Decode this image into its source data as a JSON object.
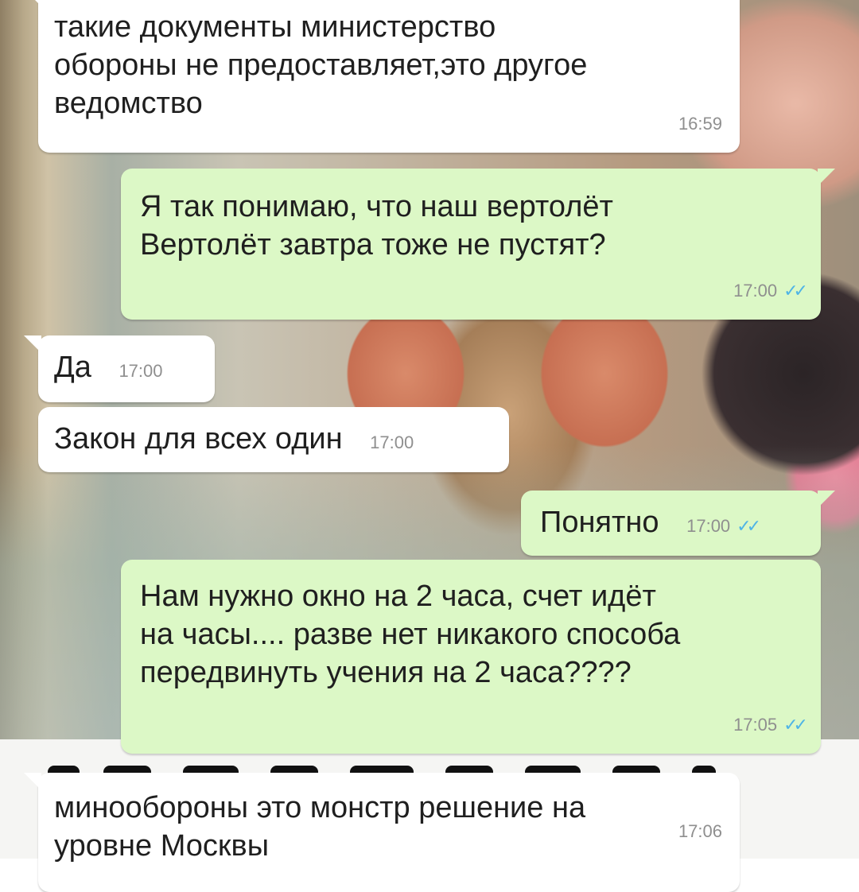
{
  "chat": {
    "messages": [
      {
        "direction": "incoming",
        "text": "такие документы министерство\nобороны не предоставляет,это другое\nведомство",
        "time": "16:59"
      },
      {
        "direction": "outgoing",
        "text": "Я так понимаю, что наш вертолёт\nВертолёт завтра тоже не пустят?",
        "time": "17:00",
        "status": "read-ticks"
      },
      {
        "direction": "incoming",
        "text": "Да",
        "time": "17:00"
      },
      {
        "direction": "incoming",
        "text": "Закон для всех один",
        "time": "17:00"
      },
      {
        "direction": "outgoing",
        "text": "Понятно",
        "time": "17:00",
        "status": "read-ticks"
      },
      {
        "direction": "outgoing",
        "text": "Нам нужно окно на 2 часа, счет идёт\nна часы.... разве нет никакого способа\nпередвинуть учения на 2 часа????",
        "time": "17:05",
        "status": "read-ticks"
      },
      {
        "direction": "incoming",
        "text": "минообороны это монстр решение на\nуровне Москвы",
        "time": "17:06"
      }
    ],
    "tick_glyph": "✓✓"
  },
  "colors": {
    "incoming_bubble": "#ffffff",
    "outgoing_bubble": "#dcf8c6",
    "read_ticks": "#4fb4e6",
    "timestamp": "#8f8f8f"
  }
}
